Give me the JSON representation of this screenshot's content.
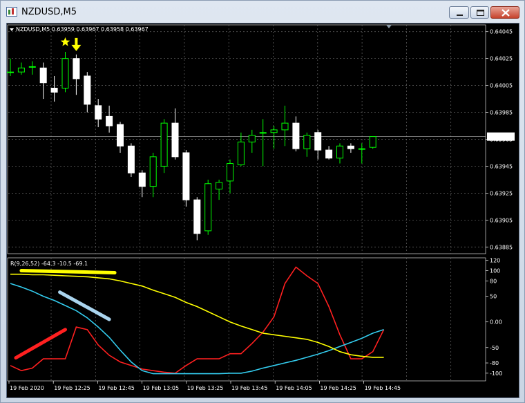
{
  "window": {
    "title": "NZDUSD,M5",
    "buttons": [
      "minimize",
      "maximize",
      "close"
    ]
  },
  "chart_data": [
    {
      "type": "candlestick",
      "symbol": "NZDUSD,M5",
      "header": "NZDUSD,M5  0.63959 0.63967 0.63958 0.63967",
      "ylim": [
        0.6388,
        0.6405
      ],
      "y_ticks": [
        "0.64045",
        "0.64025",
        "0.64005",
        "0.63985",
        "0.63965",
        "0.63945",
        "0.63925",
        "0.63905",
        "0.63885"
      ],
      "current_price_label": "0.63967",
      "current_price": 0.63967,
      "grid": true,
      "bullish_color": "#00ff00",
      "bearish_color": "#ffffff",
      "candles": [
        {
          "o": 0.64015,
          "h": 0.64025,
          "l": 0.64012,
          "c": 0.64015
        },
        {
          "o": 0.64015,
          "h": 0.64022,
          "l": 0.64013,
          "c": 0.64018
        },
        {
          "o": 0.64019,
          "h": 0.64023,
          "l": 0.64013,
          "c": 0.64019
        },
        {
          "o": 0.64018,
          "h": 0.64022,
          "l": 0.63995,
          "c": 0.64007
        },
        {
          "o": 0.64003,
          "h": 0.64012,
          "l": 0.63993,
          "c": 0.64
        },
        {
          "o": 0.64003,
          "h": 0.6403,
          "l": 0.64,
          "c": 0.64025
        },
        {
          "o": 0.64025,
          "h": 0.64028,
          "l": 0.63998,
          "c": 0.6401
        },
        {
          "o": 0.64012,
          "h": 0.64015,
          "l": 0.63985,
          "c": 0.63991
        },
        {
          "o": 0.6399,
          "h": 0.63995,
          "l": 0.63974,
          "c": 0.6398
        },
        {
          "o": 0.63982,
          "h": 0.6399,
          "l": 0.6397,
          "c": 0.63975
        },
        {
          "o": 0.63976,
          "h": 0.63978,
          "l": 0.63955,
          "c": 0.6396
        },
        {
          "o": 0.6396,
          "h": 0.63962,
          "l": 0.63937,
          "c": 0.6394
        },
        {
          "o": 0.6394,
          "h": 0.63942,
          "l": 0.63922,
          "c": 0.6393
        },
        {
          "o": 0.6393,
          "h": 0.63955,
          "l": 0.63922,
          "c": 0.63952
        },
        {
          "o": 0.63945,
          "h": 0.6398,
          "l": 0.6394,
          "c": 0.63977
        },
        {
          "o": 0.63977,
          "h": 0.63988,
          "l": 0.6395,
          "c": 0.63952
        },
        {
          "o": 0.63955,
          "h": 0.63957,
          "l": 0.63915,
          "c": 0.6392
        },
        {
          "o": 0.6392,
          "h": 0.63922,
          "l": 0.6389,
          "c": 0.63895
        },
        {
          "o": 0.63897,
          "h": 0.63935,
          "l": 0.63894,
          "c": 0.63932
        },
        {
          "o": 0.63928,
          "h": 0.63935,
          "l": 0.6392,
          "c": 0.63933
        },
        {
          "o": 0.63934,
          "h": 0.6395,
          "l": 0.63925,
          "c": 0.63947
        },
        {
          "o": 0.63946,
          "h": 0.6397,
          "l": 0.63945,
          "c": 0.63963
        },
        {
          "o": 0.63963,
          "h": 0.63972,
          "l": 0.63955,
          "c": 0.63968
        },
        {
          "o": 0.6397,
          "h": 0.6398,
          "l": 0.63945,
          "c": 0.6397
        },
        {
          "o": 0.6397,
          "h": 0.63975,
          "l": 0.63958,
          "c": 0.63972
        },
        {
          "o": 0.63972,
          "h": 0.6399,
          "l": 0.6396,
          "c": 0.63977
        },
        {
          "o": 0.63977,
          "h": 0.63982,
          "l": 0.63956,
          "c": 0.63958
        },
        {
          "o": 0.63958,
          "h": 0.6397,
          "l": 0.63952,
          "c": 0.63968
        },
        {
          "o": 0.6397,
          "h": 0.63972,
          "l": 0.6395,
          "c": 0.63957
        },
        {
          "o": 0.63957,
          "h": 0.6396,
          "l": 0.6395,
          "c": 0.63951
        },
        {
          "o": 0.63951,
          "h": 0.63962,
          "l": 0.63947,
          "c": 0.6396
        },
        {
          "o": 0.6396,
          "h": 0.63962,
          "l": 0.63955,
          "c": 0.63958
        },
        {
          "o": 0.63958,
          "h": 0.63962,
          "l": 0.63947,
          "c": 0.63958
        },
        {
          "o": 0.63959,
          "h": 0.63967,
          "l": 0.63958,
          "c": 0.63967
        }
      ],
      "annotations": [
        {
          "type": "star",
          "color": "#ffff00",
          "candle_index": 5
        },
        {
          "type": "arrow-down",
          "color": "#ffff00",
          "candle_index": 6
        }
      ]
    },
    {
      "type": "line",
      "header": "R(9,26,52) -64.3 -10.5 -69.1",
      "ylim": [
        -115,
        125
      ],
      "y_ticks": [
        "120",
        "100",
        "80",
        "50",
        "0.00",
        "-50",
        "-80",
        "-100"
      ],
      "x_labels": [
        "19 Feb 2020",
        "19 Feb 12:25",
        "19 Feb 12:45",
        "19 Feb 13:05",
        "19 Feb 13:25",
        "19 Feb 13:45",
        "19 Feb 14:05",
        "19 Feb 14:25",
        "19 Feb 14:45"
      ],
      "series": [
        {
          "color": "#ff2020",
          "values": [
            -85,
            -95,
            -90,
            -72,
            -72,
            -72,
            -10,
            -15,
            -45,
            -65,
            -78,
            -85,
            -92,
            -95,
            -98,
            -100,
            -85,
            -72,
            -72,
            -72,
            -62,
            -62,
            -42,
            -20,
            10,
            75,
            107,
            90,
            75,
            30,
            -25,
            -72,
            -72,
            -58,
            -15
          ]
        },
        {
          "color": "#33ccee",
          "values": [
            75,
            68,
            60,
            50,
            42,
            32,
            22,
            8,
            -10,
            -30,
            -55,
            -78,
            -95,
            -101,
            -101,
            -101,
            -101,
            -101,
            -101,
            -101,
            -100,
            -100,
            -96,
            -90,
            -85,
            -80,
            -75,
            -69,
            -63,
            -56,
            -48,
            -40,
            -32,
            -22,
            -15
          ]
        },
        {
          "color": "#ffff00",
          "values": [
            93,
            93,
            92,
            92,
            91,
            90,
            89,
            88,
            86,
            84,
            80,
            75,
            70,
            62,
            55,
            48,
            38,
            30,
            20,
            10,
            0,
            -8,
            -15,
            -22,
            -25,
            -28,
            -31,
            -34,
            -40,
            -48,
            -58,
            -64,
            -67,
            -69,
            -69
          ]
        }
      ],
      "drawn_lines": [
        {
          "color": "#ffff00",
          "from": {
            "x": 1,
            "y": 100
          },
          "to": {
            "x": 9.5,
            "y": 96
          }
        },
        {
          "color": "#aad4ee",
          "from": {
            "x": 4.5,
            "y": 58
          },
          "to": {
            "x": 9,
            "y": 5
          }
        },
        {
          "color": "#ff2020",
          "from": {
            "x": 0.5,
            "y": -70
          },
          "to": {
            "x": 5,
            "y": -15
          }
        }
      ]
    }
  ]
}
